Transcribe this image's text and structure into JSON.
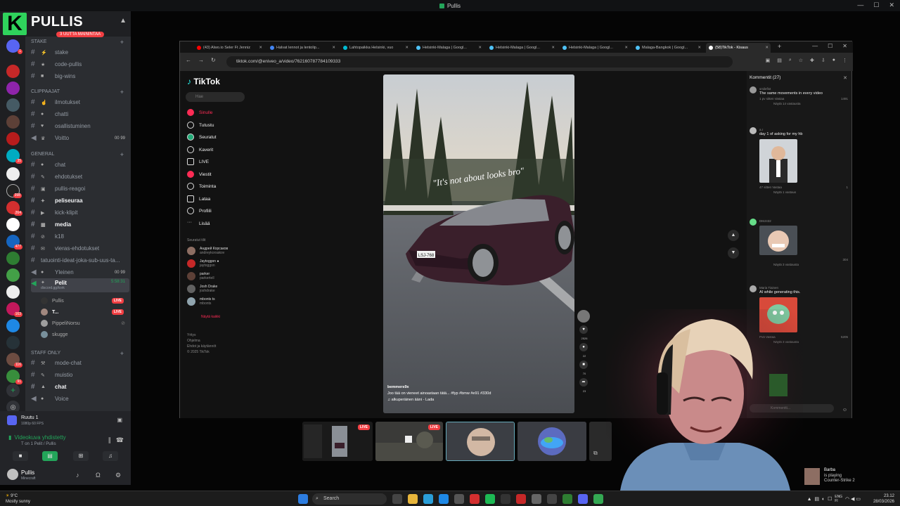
{
  "window": {
    "title": "Pullis"
  },
  "server": {
    "logo_letter": "K",
    "name": "PULLIS",
    "promo": "3 UUTTA MAININTAA"
  },
  "rail_badges": [
    "1",
    "35",
    "398",
    "264",
    "477",
    "163",
    "116",
    "91"
  ],
  "categories": [
    {
      "label": "Stake",
      "channels": [
        "stake",
        "code-pullis",
        "big-wins"
      ]
    },
    {
      "label": "CLIPPAAJAT",
      "channels": [
        "ilmotukset",
        "chatti",
        "osallistuminen",
        "Voitto"
      ]
    },
    {
      "label": "GENERAL",
      "channels": [
        "chat",
        "ehdotukset",
        "pullis-reagoi",
        "peliseuraa",
        "kick-klipit",
        "media",
        "k18",
        "vieras-ehdotukset",
        "tatuointi-ideat-joka-sub-uus-ta...",
        "Yleinen",
        "Pelit"
      ]
    },
    {
      "label": "STAFF ONLY",
      "channels": [
        "mode-chat",
        "muistio",
        "chat",
        "Voice"
      ]
    }
  ],
  "voice_counts": {
    "voitto": "00",
    "voitto_max": "99",
    "yleinen": "00",
    "yleinen_max": "99",
    "pelit_time": "5:58:31"
  },
  "pelit_sub": "discord.gg/kork",
  "voice_users": [
    {
      "name": "Pullis",
      "live": "LIVE"
    },
    {
      "name": "T...",
      "live": "LIVE"
    },
    {
      "name": "PippeliNorsu"
    },
    {
      "name": "skugge"
    }
  ],
  "voice_panel": {
    "screen_title": "Ruutu 1",
    "screen_sub": "1080p 60 FPS",
    "connected": "Videokuva yhdistetty",
    "connected_sub": "T on 1 Pelit / Pullis"
  },
  "user": {
    "name": "Pullis",
    "status": "Minecraft"
  },
  "browser": {
    "tabs": [
      "(43) Alwo.io Seler Ft Jenniz",
      "Halvat lennot ja lentolip...",
      "Lahtopaikka Helsinki, vuo",
      "Helsinki-Malaga | Googl...",
      "Helsinki-Malaga | Googl...",
      "Helsinki-Malaga | Googl...",
      "Malaga-Bangkok | Googl...",
      "(58)TikTok - Kisaus"
    ],
    "url": "tiktok.com/@eniveo_a/video/762160787784109333"
  },
  "tiktok": {
    "logo": "TikTok",
    "search_placeholder": "Hae",
    "nav": [
      "Sinulle",
      "Tutustu",
      "Seuratut",
      "Kaverit",
      "LIVE",
      "Viestit",
      "Toiminta",
      "Lataa",
      "Profiili",
      "Lisää"
    ],
    "following_header": "Seuratut tilit",
    "following": [
      {
        "name": "Андрей Корсаков",
        "sub": "andreykorsakov"
      },
      {
        "name": "Jaytoggon ●",
        "sub": "jaytoggon"
      },
      {
        "name": "parker",
        "sub": "parkertell"
      },
      {
        "name": "Josh Drake",
        "sub": "joshdrake"
      },
      {
        "name": "mbonts ts",
        "sub": "mbonts"
      }
    ],
    "show_all": "Näytä kaikki",
    "footer": [
      "Yritys",
      "Ohjelma",
      "Ehdot ja käytännöt",
      "© 2025 TikTok"
    ],
    "video_text": "\"It's not about looks bro\"",
    "plate": "LSJ-768",
    "author": "bemmers9x",
    "desc": "Joo tää on vieneet ainoastaan tätä... #fyp #bmw #e91 #330d",
    "sound": "♫ alkuperäinen ääni - Lada",
    "actions": [
      {
        "icon": "♥",
        "count": "2526"
      },
      {
        "icon": "●",
        "count": "22"
      },
      {
        "icon": "■",
        "count": "70"
      },
      {
        "icon": "➦",
        "count": "23"
      }
    ]
  },
  "comments": {
    "header": "Kommentit (27)",
    "items": [
      {
        "user": "smilefist",
        "text": "The same movements in every video",
        "meta": "1 pv sitten  Vastaa",
        "likes": "1491",
        "replies": "Näytä 14 vastausta"
      },
      {
        "user": "a.r",
        "text": "day 1 of asking for my hb",
        "meta": "47 sitten  Vastaa",
        "likes": "1",
        "replies": "Näytä 1 vastaus"
      },
      {
        "user": "DMJ432",
        "text": "",
        "meta": "",
        "likes": "304",
        "replies": "Näytä 3 vastausta"
      },
      {
        "user": "Maria Tiainen",
        "text": "AI while generating this.",
        "meta": "Pvä  Vastaa",
        "likes": "5205",
        "replies": "Näytä 3 vastausta"
      }
    ],
    "input_placeholder": "Kommentti..."
  },
  "thumbnails": {
    "live_label": "LIVE"
  },
  "friend_activity": {
    "name": "Barba",
    "status": "is playing",
    "game": "Counter-Strike 2"
  },
  "taskbar": {
    "weather_temp": "9°C",
    "weather_desc": "Mostly sunny",
    "search": "Search",
    "lang": "ENG",
    "lang_sub": "FI",
    "time": "23.12",
    "date": "28/03/2026"
  },
  "colors": {
    "accent_green": "#23a55a",
    "live_red": "#f23f43",
    "tiktok_red": "#fe2c55",
    "brand_green": "#2fd35c"
  }
}
